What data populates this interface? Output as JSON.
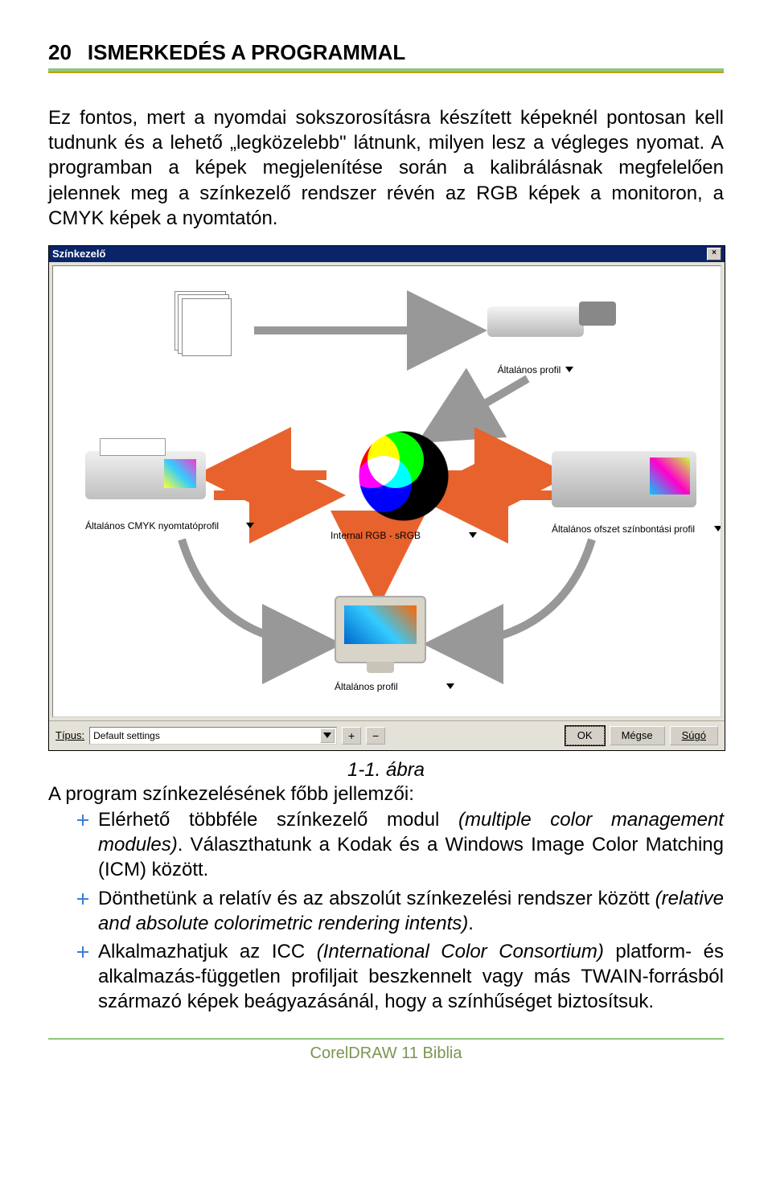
{
  "header": {
    "page_number": "20",
    "title": "ISMERKEDÉS A PROGRAMMAL"
  },
  "paragraphs": {
    "p1": "Ez fontos, mert a nyomdai sokszorosításra készített képeknél pontosan kell tudnunk és a lehető „legközelebb\" látnunk, milyen lesz a végleges nyomat. A programban a képek megjelenítése során a kalibrálásnak megfelelően jelennek meg a színkezelő rendszer révén az RGB képek a monitoron, a CMYK képek a nyomtatón."
  },
  "dialog": {
    "title": "Színkezelő",
    "close_glyph": "×",
    "labels": {
      "scanner": "Általános profil",
      "internal": "Internal RGB - sRGB",
      "printer": "Általános CMYK nyomtatóprofil",
      "press": "Általános ofszet színbontási profil",
      "monitor": "Általános profil"
    },
    "bottom": {
      "type_label": "Típus:",
      "combo_value": "Default settings",
      "plus": "+",
      "minus": "−",
      "ok": "OK",
      "cancel": "Mégse",
      "help": "Súgó"
    }
  },
  "caption": "1-1. ábra",
  "list_intro": "A program színkezelésének főbb jellemzői:",
  "bullets": [
    {
      "pre": "Elérhető többféle színkezelő modul ",
      "it": "(multiple color management modules)",
      "post": ". Választhatunk a Kodak és a Windows Image Color Matching (ICM) között."
    },
    {
      "pre": "Dönthetünk a relatív és az abszolút színkezelési rendszer között ",
      "it": "(relative and absolute colorimetric rendering intents)",
      "post": "."
    },
    {
      "pre": "Alkalmazhatjuk az ICC ",
      "it": "(International Color Consortium)",
      "post": " platform- és alkalmazás-független profiljait beszkennelt vagy más TWAIN-forrásból származó képek beágyazásánál, hogy a színhűséget biztosítsuk."
    }
  ],
  "footer": "CorelDRAW 11 Biblia"
}
